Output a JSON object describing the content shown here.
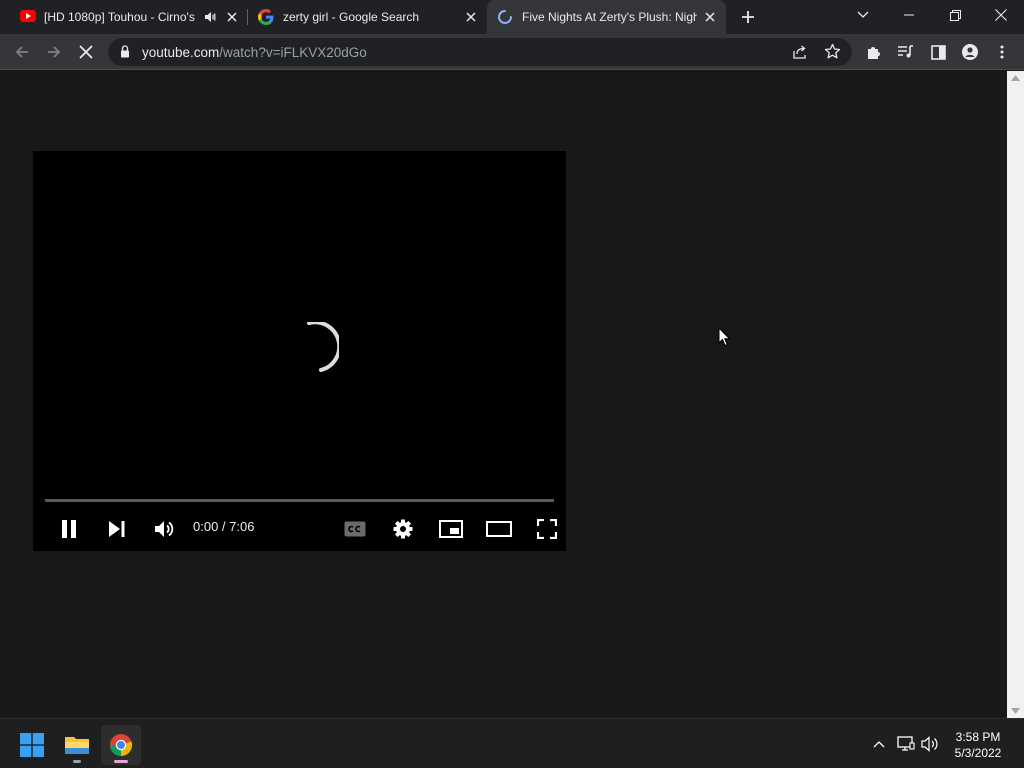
{
  "tabs": [
    {
      "title": "[HD 1080p] Touhou - Cirno's",
      "icon": "youtube-icon",
      "audio": "mute-speaker-icon"
    },
    {
      "title": "zerty girl - Google Search",
      "icon": "google-icon"
    },
    {
      "title": "Five Nights At Zerty's Plush: Nigh",
      "icon": "loading-spinner-icon",
      "active": true
    }
  ],
  "new_tab_label": "+",
  "address": {
    "host": "youtube.com",
    "path": "/watch?v=iFLKVX20dGo"
  },
  "player": {
    "time": "0:00 / 7:06",
    "progress": 0.0
  },
  "clock": {
    "time": "3:58 PM",
    "date": "5/3/2022"
  },
  "colors": {
    "tab_bar": "#202124",
    "toolbar": "#35363a",
    "page": "#181818",
    "accent_chrome": "#e2a8d3",
    "progress": "#ff0000"
  }
}
